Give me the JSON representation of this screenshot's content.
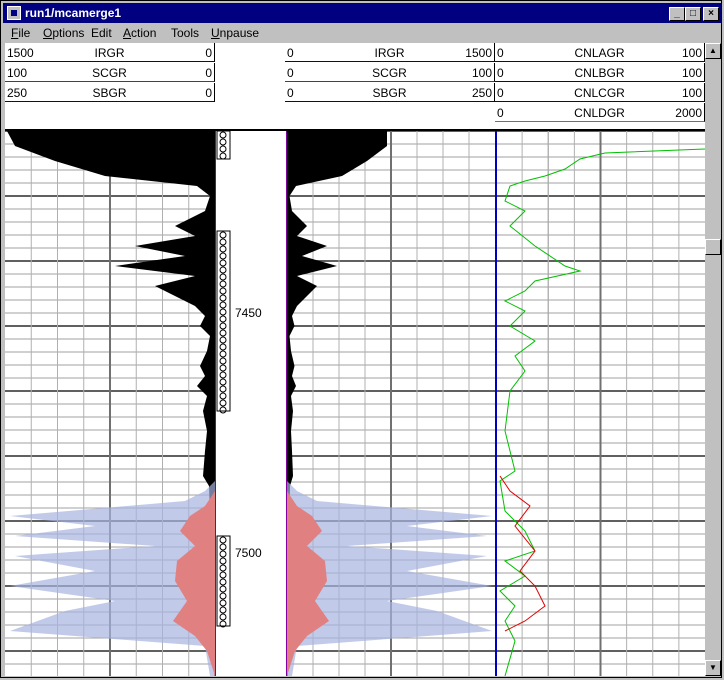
{
  "window": {
    "title": "run1/mcamerge1"
  },
  "menu": [
    {
      "label": "File",
      "u": "F",
      "rest": "ile"
    },
    {
      "label": "Options",
      "u": "O",
      "rest": "ptions"
    },
    {
      "label": "Edit",
      "u": "",
      "rest": "Edit"
    },
    {
      "label": "Action",
      "u": "A",
      "rest": "ction"
    },
    {
      "label": "Tools",
      "u": "",
      "rest": "Tools"
    },
    {
      "label": "Unpause",
      "u": "U",
      "rest": "npause"
    }
  ],
  "tracks": {
    "left": [
      {
        "min": "1500",
        "name": "IRGR",
        "max": "0",
        "color": "#0000a0"
      },
      {
        "min": "100",
        "name": "SCGR",
        "max": "0",
        "color": "#e00000"
      },
      {
        "min": "250",
        "name": "SBGR",
        "max": "0",
        "color": "#0000a0"
      }
    ],
    "right": [
      {
        "min": "0",
        "name": "IRGR",
        "max": "1500",
        "color": "#0000a0"
      },
      {
        "min": "0",
        "name": "SCGR",
        "max": "100",
        "color": "#e00000"
      },
      {
        "min": "0",
        "name": "SBGR",
        "max": "250",
        "color": "#0000a0"
      }
    ],
    "far": [
      {
        "min": "0",
        "name": "CNLAGR",
        "max": "100",
        "color": "#0000a0"
      },
      {
        "min": "0",
        "name": "CNLBGR",
        "max": "100",
        "color": "#0000a0"
      },
      {
        "min": "0",
        "name": "CNLCGR",
        "max": "100",
        "color": "#0000a0"
      },
      {
        "min": "0",
        "name": "CNLDGR",
        "max": "2000",
        "color": "#00c000"
      }
    ]
  },
  "depth": {
    "labels": [
      "7450",
      "7500"
    ]
  },
  "colors": {
    "titlebar": "#000080",
    "fill_black": "#000000",
    "fill_red": "#e08080",
    "fill_blue": "#a8b4e0",
    "green": "#00c000",
    "red": "#e00000",
    "blue": "#0000c0"
  }
}
